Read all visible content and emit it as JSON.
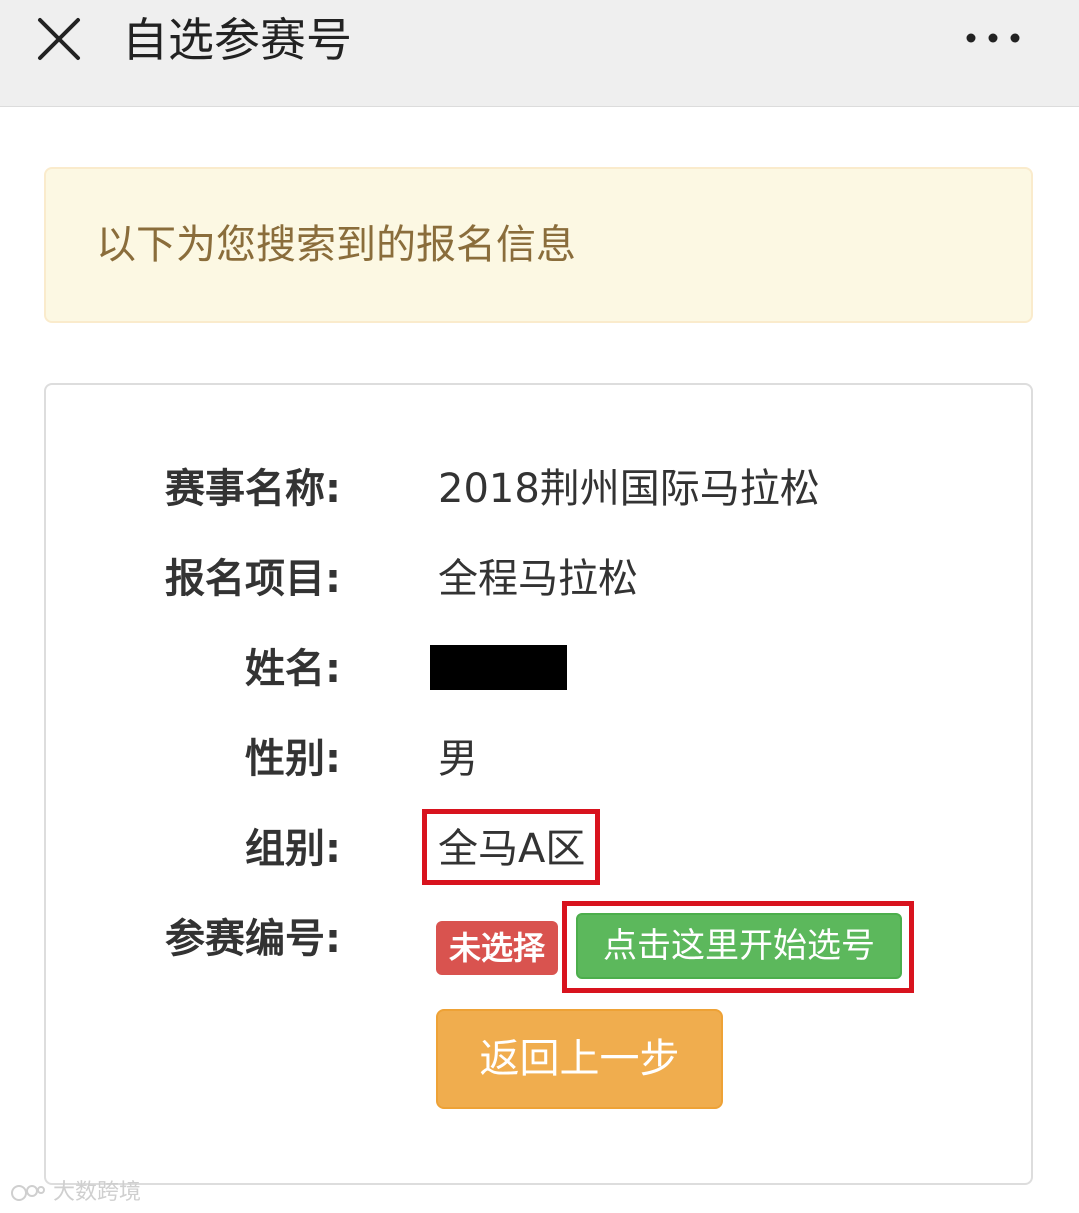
{
  "header": {
    "title": "自选参赛号"
  },
  "notice": {
    "text": "以下为您搜索到的报名信息"
  },
  "info": {
    "event_label": "赛事名称:",
    "event_value": "2018荆州国际马拉松",
    "item_label": "报名项目:",
    "item_value": "全程马拉松",
    "name_label": "姓名:",
    "gender_label": "性别:",
    "gender_value": "男",
    "group_label": "组别:",
    "group_value": "全马A区",
    "bib_label": "参赛编号:",
    "bib_status": "未选择"
  },
  "buttons": {
    "choose": "点击这里开始选号",
    "back": "返回上一步"
  },
  "watermark": {
    "text": "大数跨境"
  },
  "colors": {
    "notice_bg": "#fcf8e3",
    "notice_text": "#8a6d3b",
    "badge_danger": "#d9534f",
    "button_success": "#5cb85c",
    "button_warning": "#f0ad4e",
    "highlight_box": "#d8131e"
  }
}
